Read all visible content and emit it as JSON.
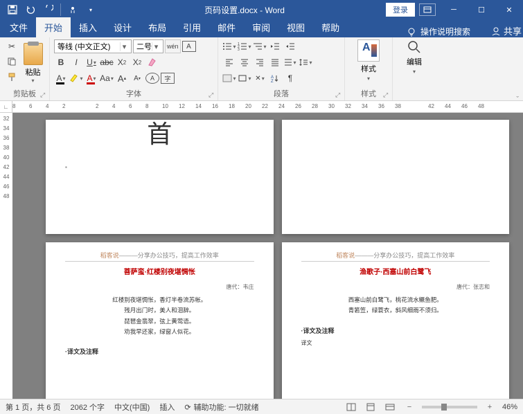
{
  "titlebar": {
    "doc_title": "页码设置.docx - Word",
    "login": "登录"
  },
  "tabs": {
    "file": "文件",
    "home": "开始",
    "insert": "插入",
    "design": "设计",
    "layout": "布局",
    "references": "引用",
    "mail": "邮件",
    "review": "审阅",
    "view": "视图",
    "help": "帮助",
    "tellme": "操作说明搜索",
    "share": "共享"
  },
  "ribbon": {
    "clipboard": {
      "label": "剪贴板",
      "paste": "粘贴"
    },
    "font": {
      "label": "字体",
      "name": "等线 (中文正文)",
      "size": "二号",
      "wen": "wén"
    },
    "paragraph": {
      "label": "段落"
    },
    "styles": {
      "label": "样式",
      "btn": "样式"
    },
    "editing": {
      "label": "",
      "btn": "编辑"
    }
  },
  "ruler_h": [
    "8",
    "6",
    "4",
    "2",
    " ",
    "2",
    "4",
    "6",
    "8",
    "10",
    "12",
    "14",
    "16",
    "18",
    "20",
    "22",
    "24",
    "26",
    "28",
    "30",
    "32",
    "34",
    "36",
    "38",
    " ",
    "42",
    "44",
    "46",
    "48"
  ],
  "ruler_v": [
    "32",
    "34",
    "36",
    "38",
    "40",
    "42",
    "44",
    "46",
    "48"
  ],
  "pages": {
    "p1": {
      "big": "首"
    },
    "header_text_a": "稻客说",
    "header_text_b": "———分享办公技巧，提高工作效率",
    "p3": {
      "title": "菩萨蛮·红楼别夜堪惆怅",
      "byline": "唐代：韦庄",
      "lines": [
        "红楼别夜堪惆怅，香灯半卷流苏帐。",
        "残月出门时，美人和泪辞。",
        "琵琶金翡翠，弦上黄莺语。",
        "劝我早还家，绿窗人似花。"
      ],
      "section": "·译文及注释"
    },
    "p4": {
      "title": "渔歌子·西塞山前白鹭飞",
      "byline": "唐代：张志和",
      "lines": [
        "西塞山前白鹭飞，桃花流水鳜鱼肥。",
        "青箬笠，绿蓑衣，斜风细雨不须归。"
      ],
      "section": "·译文及注释",
      "sub": "译文"
    }
  },
  "status": {
    "page": "第 1 页，共 6 页",
    "words": "2062 个字",
    "lang": "中文(中国)",
    "mode": "插入",
    "a11y": "辅助功能: 一切就绪",
    "zoom": "46%",
    "zoom_val": 46
  }
}
